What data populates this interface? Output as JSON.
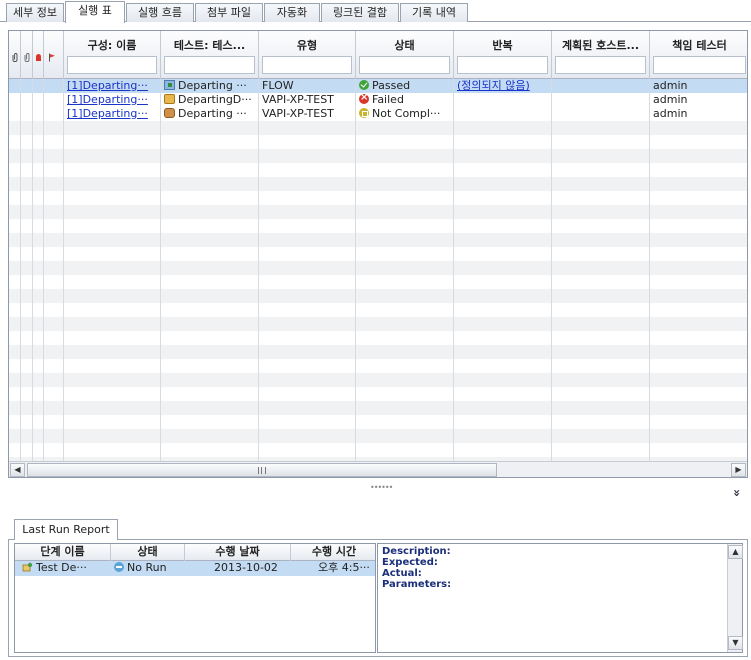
{
  "tabs": [
    {
      "label": "세부 정보",
      "active": false
    },
    {
      "label": "실행 표",
      "active": true
    },
    {
      "label": "실행 흐름",
      "active": false
    },
    {
      "label": "첨부 파일",
      "active": false
    },
    {
      "label": "자동화",
      "active": false
    },
    {
      "label": "링크된 결함",
      "active": false
    },
    {
      "label": "기록 내역",
      "active": false
    }
  ],
  "grid": {
    "columns": [
      {
        "label": "구성: 이름"
      },
      {
        "label": "테스트: 테스..."
      },
      {
        "label": "유형"
      },
      {
        "label": "상태"
      },
      {
        "label": "반복"
      },
      {
        "label": "계획된 호스트..."
      },
      {
        "label": "책임 테스터"
      }
    ],
    "header_icons": [
      "attachment-icon",
      "attachment-alt-icon",
      "alert-icon",
      "flag-icon"
    ],
    "rows": [
      {
        "config_name": "[1]Departing···",
        "test_name": "Departing ···",
        "test_icon": "flow-test-icon",
        "type": "FLOW",
        "status": "Passed",
        "status_icon": "passed-icon",
        "iterations": "(정의되지 않음)",
        "planned_host": "",
        "responsible_tester": "admin"
      },
      {
        "config_name": "[1]Departing···",
        "test_name": "DepartingD···",
        "test_icon": "vapi-test-icon",
        "type": "VAPI-XP-TEST",
        "status": "Failed",
        "status_icon": "failed-icon",
        "iterations": "",
        "planned_host": "",
        "responsible_tester": "admin"
      },
      {
        "config_name": "[1]Departing···",
        "test_name": "Departing ···",
        "test_icon": "vapi-test-icon",
        "type": "VAPI-XP-TEST",
        "status": "Not Compl···",
        "status_icon": "not-completed-icon",
        "iterations": "",
        "planned_host": "",
        "responsible_tester": "admin"
      }
    ]
  },
  "scrollbar": {
    "left_arrow": "◀",
    "right_arrow": "▶"
  },
  "splitter": {
    "collapse_glyph": "»"
  },
  "report": {
    "tab_label": "Last Run Report",
    "columns": [
      "단계 이름",
      "상태",
      "수행 날짜",
      "수행 시간"
    ],
    "steps": [
      {
        "name": "Test De···",
        "status": "No Run",
        "date": "2013-10-02",
        "time": "오후 4:5···"
      }
    ],
    "details": {
      "description_label": "Description:",
      "expected_label": "Expected:",
      "actual_label": "Actual:",
      "parameters_label": "Parameters:"
    },
    "vscroll": {
      "up_arrow": "▲",
      "down_arrow": "▼"
    }
  },
  "colors": {
    "selection": "#c4dcf3",
    "link": "#1a33c8",
    "passed": "#3fa33b",
    "failed": "#d9352a",
    "not_completed": "#c9b52b",
    "no_run": "#5aa4d6"
  }
}
